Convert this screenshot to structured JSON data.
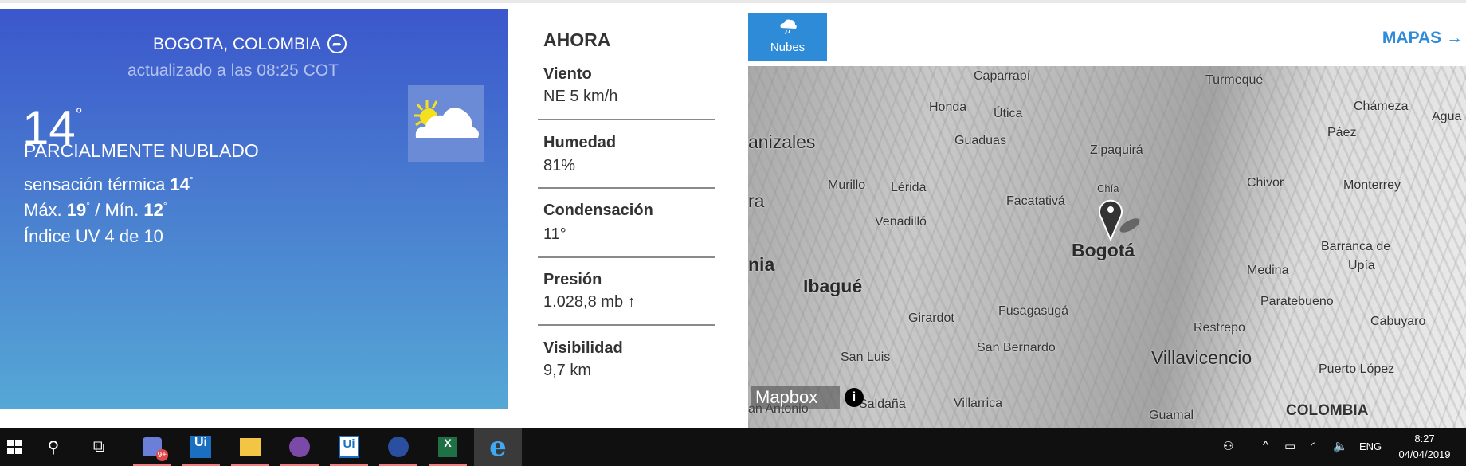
{
  "current": {
    "location": "BOGOTA, COLOMBIA",
    "updated": "actualizado a las 08:25 COT",
    "temperature": "14",
    "degree": "°",
    "condition": "PARCIALMENTE NUBLADO",
    "feels_label": "sensación térmica",
    "feels_value": "14",
    "max_label": "Máx.",
    "max_value": "19",
    "min_label": "/ Mín.",
    "min_value": "12",
    "uv": "Índice UV 4 de 10",
    "icon": "partly-cloudy-icon"
  },
  "now": {
    "title": "AHORA",
    "items": [
      {
        "label": "Viento",
        "value": "NE 5 km/h"
      },
      {
        "label": "Humedad",
        "value": "81%"
      },
      {
        "label": "Condensación",
        "value": "11°"
      },
      {
        "label": "Presión",
        "value": "1.028,8 mb",
        "trend": "↑"
      },
      {
        "label": "Visibilidad",
        "value": "9,7 km"
      }
    ]
  },
  "map": {
    "layer_button": "Nubes",
    "maps_link": "MAPAS →",
    "attribution": "Mapbox",
    "info": "i",
    "labels": [
      "Caparrapí",
      "Turmequé",
      "Honda",
      "Útica",
      "Chámeza",
      "Agua",
      "anizales",
      "Guaduas",
      "Páez",
      "Zipaquirá",
      "Murillo",
      "Lérida",
      "Chía",
      "Chivor",
      "Monterrey",
      "ra",
      "Facatativá",
      "Venadilló",
      "Bogotá",
      "Barranca de",
      "Upía",
      "nia",
      "Medina",
      "Ibagué",
      "Paratebueno",
      "Girardot",
      "Fusagasugá",
      "Restrepo",
      "Cabuyaro",
      "San Bernardo",
      "San Luis",
      "Villavicencio",
      "Puerto López",
      "Saldaña",
      "Villarrica",
      "Guamal",
      "COLOMBIA",
      "an Antonio"
    ]
  },
  "taskbar": {
    "badge": "9+",
    "lang": "ENG",
    "time": "8:27",
    "date": "04/04/2019"
  },
  "colors": {
    "accent": "#2e8bd8",
    "panel_top": "#3b57cc",
    "panel_bottom": "#55a8d6",
    "taskbar": "#101010"
  }
}
